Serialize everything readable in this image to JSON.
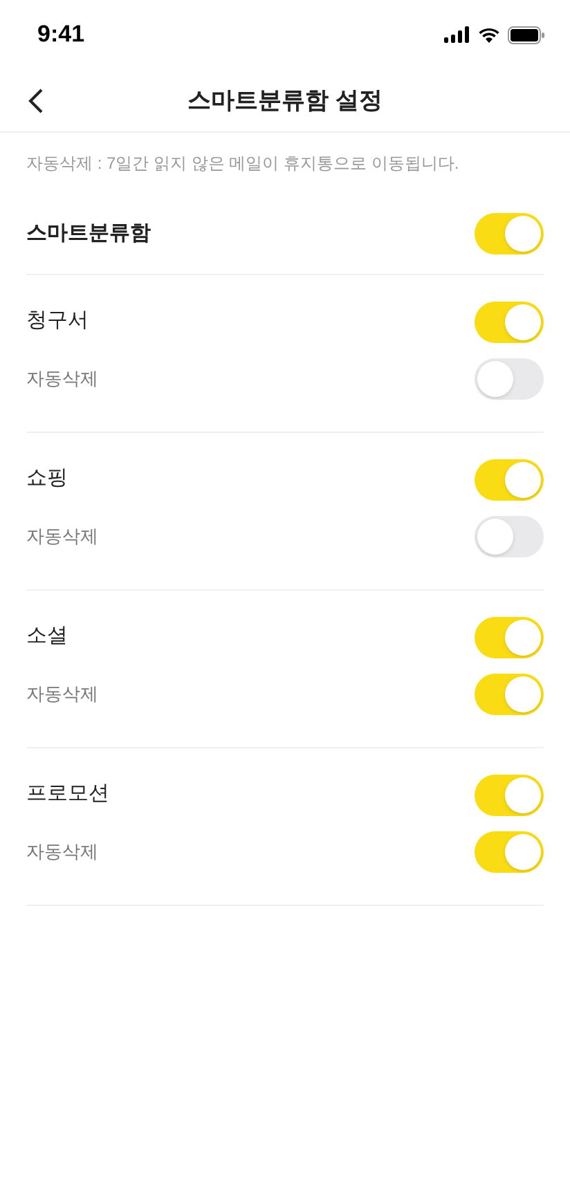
{
  "status_bar": {
    "time": "9:41"
  },
  "header": {
    "title": "스마트분류함 설정"
  },
  "notice": "자동삭제 : 7일간 읽지 않은 메일이 휴지통으로 이동됩니다.",
  "smart_folder": {
    "label": "스마트분류함",
    "on": true
  },
  "categories": [
    {
      "label": "청구서",
      "on": true,
      "auto_delete": {
        "label": "자동삭제",
        "on": false
      }
    },
    {
      "label": "쇼핑",
      "on": true,
      "auto_delete": {
        "label": "자동삭제",
        "on": false
      }
    },
    {
      "label": "소셜",
      "on": true,
      "auto_delete": {
        "label": "자동삭제",
        "on": true
      }
    },
    {
      "label": "프로모션",
      "on": true,
      "auto_delete": {
        "label": "자동삭제",
        "on": true
      }
    }
  ]
}
